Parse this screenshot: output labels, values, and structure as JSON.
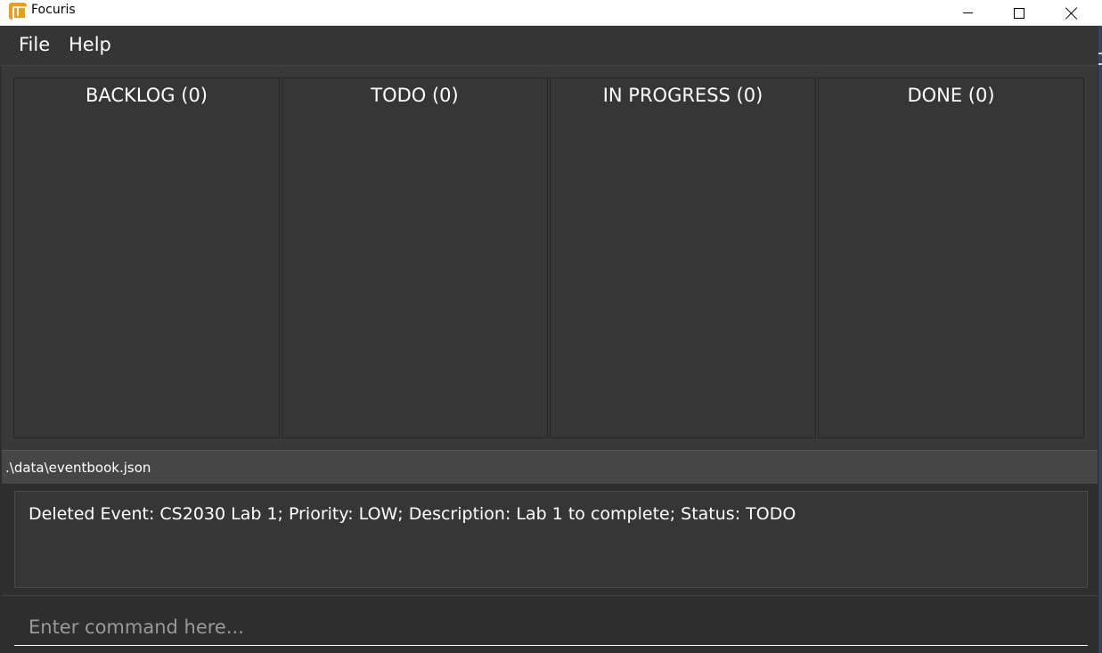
{
  "window": {
    "title": "Focuris",
    "controls": [
      "minimize-icon",
      "maximize-icon",
      "close-icon"
    ]
  },
  "menu": {
    "file": "File",
    "help": "Help"
  },
  "board": {
    "columns": [
      {
        "label": "BACKLOG (0)"
      },
      {
        "label": "TODO (0)"
      },
      {
        "label": "IN PROGRESS (0)"
      },
      {
        "label": "DONE (0)"
      }
    ]
  },
  "status": {
    "path": ".\\data\\eventbook.json"
  },
  "result": {
    "message": "Deleted Event: CS2030 Lab 1; Priority: LOW; Description: Lab 1 to complete; Status: TODO"
  },
  "command": {
    "value": "",
    "placeholder": "Enter command here..."
  },
  "colors": {
    "background": "#2e2e2e",
    "panel": "#363636",
    "accent": "#f19b1a",
    "text": "#ffffff"
  }
}
